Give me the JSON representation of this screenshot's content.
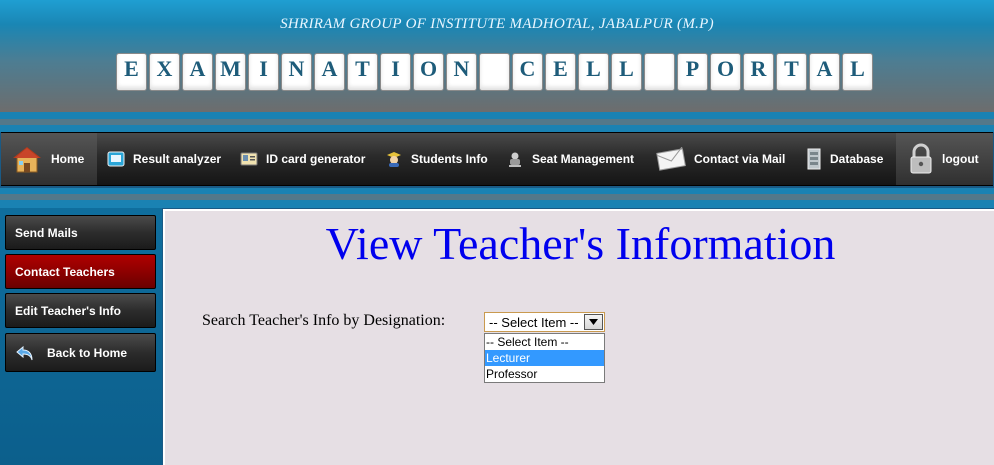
{
  "header": {
    "subtitle": "SHRIRAM GROUP OF INSTITUTE MADHOTAL, JABALPUR (M.P)",
    "title_letters": [
      "E",
      "X",
      "A",
      "M",
      "I",
      "N",
      "A",
      "T",
      "I",
      "O",
      "N",
      " ",
      "C",
      "E",
      "L",
      "L",
      " ",
      "P",
      "O",
      "R",
      "T",
      "A",
      "L"
    ]
  },
  "nav": {
    "items": [
      {
        "label": "Home",
        "icon": "house-icon"
      },
      {
        "label": "Result analyzer",
        "icon": "result-icon"
      },
      {
        "label": "ID card generator",
        "icon": "id-card-icon"
      },
      {
        "label": "Students Info",
        "icon": "students-icon"
      },
      {
        "label": "Seat Management",
        "icon": "seat-icon"
      },
      {
        "label": "Contact via Mail",
        "icon": "envelope-icon"
      },
      {
        "label": "Database",
        "icon": "database-icon"
      },
      {
        "label": "logout",
        "icon": "lock-icon"
      }
    ]
  },
  "sidebar": {
    "items": [
      {
        "label": "Send Mails"
      },
      {
        "label": "Contact Teachers"
      },
      {
        "label": "Edit Teacher's Info"
      },
      {
        "label": "Back to Home",
        "icon": "back-arrow-icon"
      }
    ]
  },
  "main": {
    "title": "View Teacher's Information",
    "search_label": "Search Teacher's Info by Designation:",
    "select": {
      "value": "-- Select Item --",
      "options": [
        "-- Select Item --",
        "Lecturer",
        "Professor"
      ]
    }
  },
  "colors": {
    "title_blue": "#0000ee",
    "active_red": "#9a0000",
    "highlight": "#3399ff"
  }
}
